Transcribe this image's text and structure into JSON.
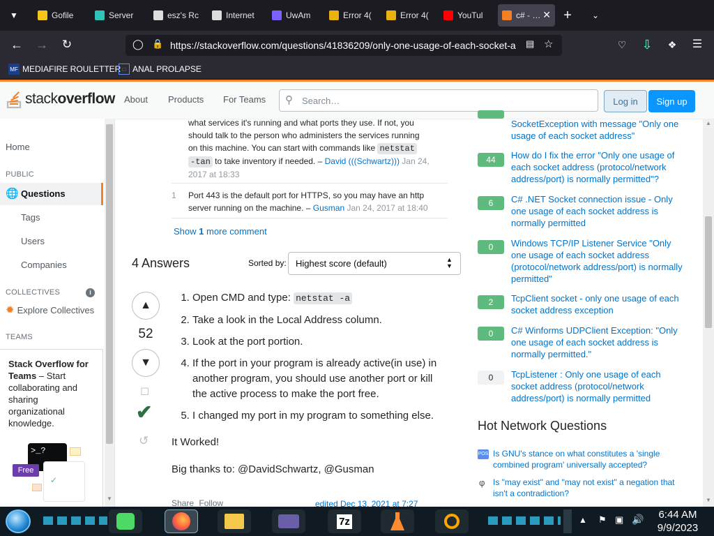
{
  "browser": {
    "tabs": [
      {
        "label": "Gofile",
        "icon": "gofile-icon",
        "color": "#f5c518"
      },
      {
        "label": "Server",
        "icon": "info-icon",
        "color": "#2ec4b6"
      },
      {
        "label": "esz's Rc",
        "icon": "archive-icon",
        "color": "#dddddd"
      },
      {
        "label": "Internet",
        "icon": "archive-icon",
        "color": "#dddddd"
      },
      {
        "label": "UwAm",
        "icon": "uwu-icon",
        "color": "#7b61ff"
      },
      {
        "label": "Error 4(",
        "icon": "error-icon",
        "color": "#e9b20e"
      },
      {
        "label": "Error 4(",
        "icon": "error-icon",
        "color": "#e9b20e"
      },
      {
        "label": "YouTul",
        "icon": "youtube-icon",
        "color": "#ff0000"
      },
      {
        "label": "c# - …",
        "icon": "stackoverflow-icon",
        "color": "#f48024"
      }
    ],
    "url": "https://stackoverflow.com/questions/41836209/only-one-usage-of-each-socket-a",
    "bookmarks": [
      {
        "label": "MEDIAFIRE ROULETTER",
        "icon": "mediafire-icon"
      },
      {
        "label": "ANAL PROLAPSE",
        "icon": "bookmark-icon"
      }
    ]
  },
  "so_header": {
    "logo_text_1": "stack",
    "logo_text_2": "overflow",
    "nav": [
      "About",
      "Products",
      "For Teams"
    ],
    "search_placeholder": "Search…",
    "login": "Log in",
    "signup": "Sign up"
  },
  "left_nav": {
    "home": "Home",
    "public": "PUBLIC",
    "questions": "Questions",
    "tags": "Tags",
    "users": "Users",
    "companies": "Companies",
    "collectives": "COLLECTIVES",
    "explore_collectives": "Explore Collectives",
    "teams": "TEAMS",
    "teams_title": "Stack Overflow for Teams",
    "teams_dash": " – Start collaborating and sharing organizational knowledge.",
    "free_badge": "Free"
  },
  "comments": {
    "c1_line1": "what services it's running and what ports they use. If not, you",
    "c1_line2": "should talk to the person who administers the services running",
    "c1_line3a": "on this machine. You can start with commands like",
    "c1_code1": "netstat",
    "c1_code2": "-tan",
    "c1_line4": "to take inventory if needed. –",
    "c1_user": "David (((Schwartz)))",
    "c1_date_a": "Jan 24,",
    "c1_date_b": "2017 at 18:33",
    "c2_score": "1",
    "c2_line1": "Port 443 is the default port for HTTPS, so you may have an http",
    "c2_line2": "server running on the machine. –",
    "c2_user": "Gusman",
    "c2_date": "Jan 24, 2017 at 18:40",
    "show_more_a": "Show ",
    "show_more_n": "1",
    "show_more_b": " more comment"
  },
  "answers": {
    "count_label": "4 Answers",
    "sorted_by": "Sorted by:",
    "sort_value": "Highest score (default)",
    "score": "52",
    "steps": [
      "Open CMD and type:",
      "Take a look in the Local Address column.",
      "Look at the port portion.",
      "If the port in your program is already active(in use) in another program, you should use another port or kill the active process to make the port free.",
      "I changed my port in my program to something else."
    ],
    "step1_code": "netstat -a",
    "it_worked": "It Worked!",
    "thanks": "Big thanks to: @DavidSchwartz, @Gusman",
    "share": "Share",
    "follow": "Follow",
    "edited": "edited Dec 13, 2021 at 7:27"
  },
  "related": [
    {
      "score": "",
      "title": "SocketException with message \"Only one usage of each socket address\""
    },
    {
      "score": "44",
      "title": "How do I fix the error \"Only one usage of each socket address (protocol/network address/port) is normally permitted\"?"
    },
    {
      "score": "6",
      "title": "C# .NET Socket connection issue - Only one usage of each socket address is normally permitted"
    },
    {
      "score": "0",
      "title": "Windows TCP/IP Listener Service \"Only one usage of each socket address (protocol/network address/port) is normally permitted\""
    },
    {
      "score": "2",
      "title": "TcpClient socket - only one usage of each socket address exception"
    },
    {
      "score": "0",
      "title": "C# Winforms UDPClient Exception: \"Only one usage of each socket address is normally permitted.\""
    },
    {
      "score": "0",
      "title": "TcpListener : Only one usage of each socket address (protocol/network address/port) is normally permitted"
    }
  ],
  "hot_network": {
    "title": "Hot Network Questions",
    "items": [
      "Is GNU's stance on what constitutes a 'single combined program' universally accepted?",
      "Is \"may exist\" and \"may not exist\" a negation that isn't a contradiction?"
    ]
  },
  "taskbar": {
    "time": "6:44 AM",
    "date": "9/9/2023",
    "apps": [
      "notes-icon",
      "firefox-icon",
      "file-explorer-icon",
      "media-player-icon",
      "7zip-icon",
      "flask-icon",
      "search-icon"
    ],
    "seven_zip": "7z"
  }
}
